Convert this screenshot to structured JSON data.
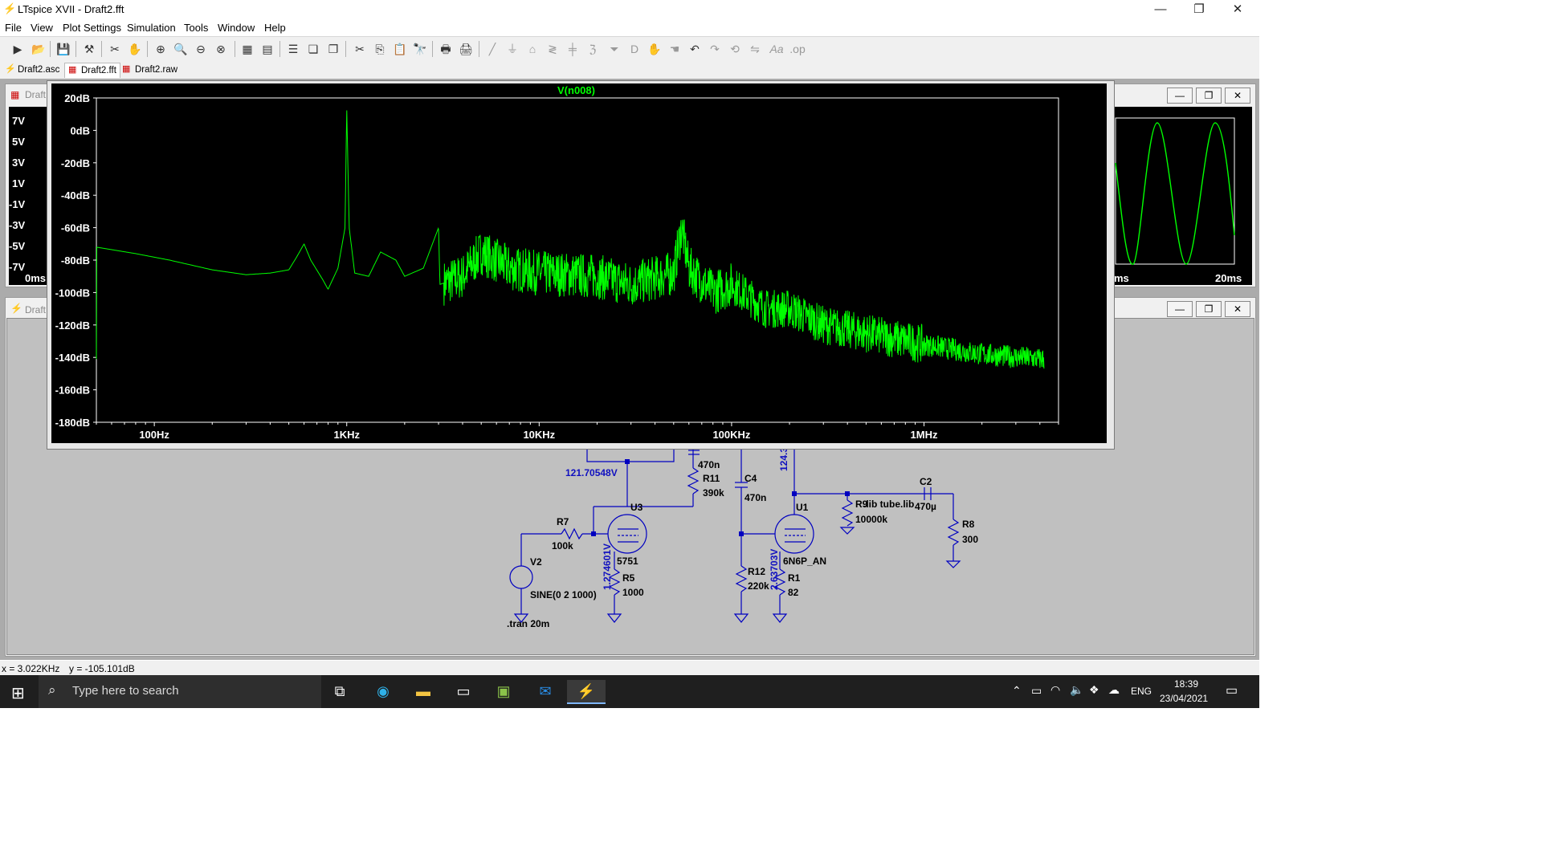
{
  "window": {
    "title": "LTspice XVII - Draft2.fft",
    "controls": [
      "—",
      "❐",
      "✕"
    ]
  },
  "menu": [
    "File",
    "View",
    "Plot Settings",
    "Simulation",
    "Tools",
    "Window",
    "Help"
  ],
  "tabs": [
    {
      "label": "Draft2.asc",
      "icon": "schematic-icon"
    },
    {
      "label": "Draft2.fft",
      "icon": "waveform-icon",
      "active": true
    },
    {
      "label": "Draft2.raw",
      "icon": "waveform-icon"
    }
  ],
  "fft": {
    "trace_label": "V(n008)",
    "trace_color": "#00ff00",
    "y_ticks": [
      "20dB",
      "0dB",
      "-20dB",
      "-40dB",
      "-60dB",
      "-80dB",
      "-100dB",
      "-120dB",
      "-140dB",
      "-160dB",
      "-180dB"
    ],
    "x_ticks": [
      "100Hz",
      "1KHz",
      "10KHz",
      "100KHz",
      "1MHz"
    ],
    "chart_data": {
      "type": "line",
      "xlabel": "",
      "ylabel": "",
      "x_scale": "log",
      "xlim_hz": [
        50,
        5000000
      ],
      "ylim_db": [
        -180,
        20
      ],
      "grid": false,
      "series": [
        {
          "name": "V(n008)",
          "points_hz_db": [
            [
              50,
              -72
            ],
            [
              80,
              -76
            ],
            [
              120,
              -80
            ],
            [
              200,
              -86
            ],
            [
              300,
              -89
            ],
            [
              400,
              -88
            ],
            [
              500,
              -86
            ],
            [
              550,
              -78
            ],
            [
              600,
              -70
            ],
            [
              650,
              -80
            ],
            [
              750,
              -92
            ],
            [
              800,
              -98
            ],
            [
              900,
              -85
            ],
            [
              980,
              -60
            ],
            [
              1000,
              13
            ],
            [
              1030,
              -60
            ],
            [
              1100,
              -88
            ],
            [
              1300,
              -90
            ],
            [
              1500,
              -75
            ],
            [
              1800,
              -80
            ],
            [
              2000,
              -90
            ],
            [
              2500,
              -85
            ],
            [
              3000,
              -60
            ],
            [
              3050,
              -95
            ],
            [
              4000,
              -90
            ],
            [
              5000,
              -75
            ],
            [
              7000,
              -85
            ],
            [
              10000,
              -88
            ],
            [
              20000,
              -90
            ],
            [
              30000,
              -95
            ],
            [
              50000,
              -88
            ],
            [
              55000,
              -60
            ],
            [
              60000,
              -85
            ],
            [
              80000,
              -100
            ],
            [
              100000,
              -95
            ],
            [
              150000,
              -110
            ],
            [
              200000,
              -110
            ],
            [
              300000,
              -120
            ],
            [
              500000,
              -125
            ],
            [
              1000000,
              -132
            ],
            [
              2000000,
              -138
            ],
            [
              4000000,
              -141
            ]
          ]
        }
      ]
    }
  },
  "left_plot": {
    "title": "Draft",
    "y_ticks": [
      "7V",
      "5V",
      "3V",
      "1V",
      "-1V",
      "-3V",
      "-5V",
      "-7V"
    ],
    "x_start": "0ms"
  },
  "right_plot": {
    "x_left": "ms",
    "x_right": "20ms"
  },
  "schematic": {
    "title": "Draft",
    "labels": {
      "node_voltage_1": "121.70548V",
      "node_voltage_2": "124.3",
      "node_voltage_3": "1.274601V",
      "node_voltage_4": "2.63703V",
      "c_470n_top": "470n",
      "r11": "R11",
      "r11_val": "390k",
      "c4": "C4",
      "c4_val": "470n",
      "u3": "U3",
      "u3_type": "5751",
      "r7": "R7",
      "r7_val": "100k",
      "v2": "V2",
      "v2_src": "SINE(0 2 1000)",
      "r5": "R5",
      "r5_val": "1000",
      "tran": ".tran 20m",
      "r12": "R12",
      "r12_val": "220k",
      "u1": "U1",
      "u1_type": "6N6P_AN",
      "r1": "R1",
      "r1_val": "82",
      "r9": "R9",
      "lib": ".lib tube.lib",
      "r9_val": "10000k",
      "c2": "C2",
      "c2_val": "470µ",
      "r8": "R8",
      "r8_val": "300"
    }
  },
  "status": {
    "x": "x = 3.022KHz",
    "y": "y = -105.101dB"
  },
  "taskbar": {
    "search_placeholder": "Type here to search",
    "lang": "ENG",
    "time": "18:39",
    "date": "23/04/2021"
  }
}
